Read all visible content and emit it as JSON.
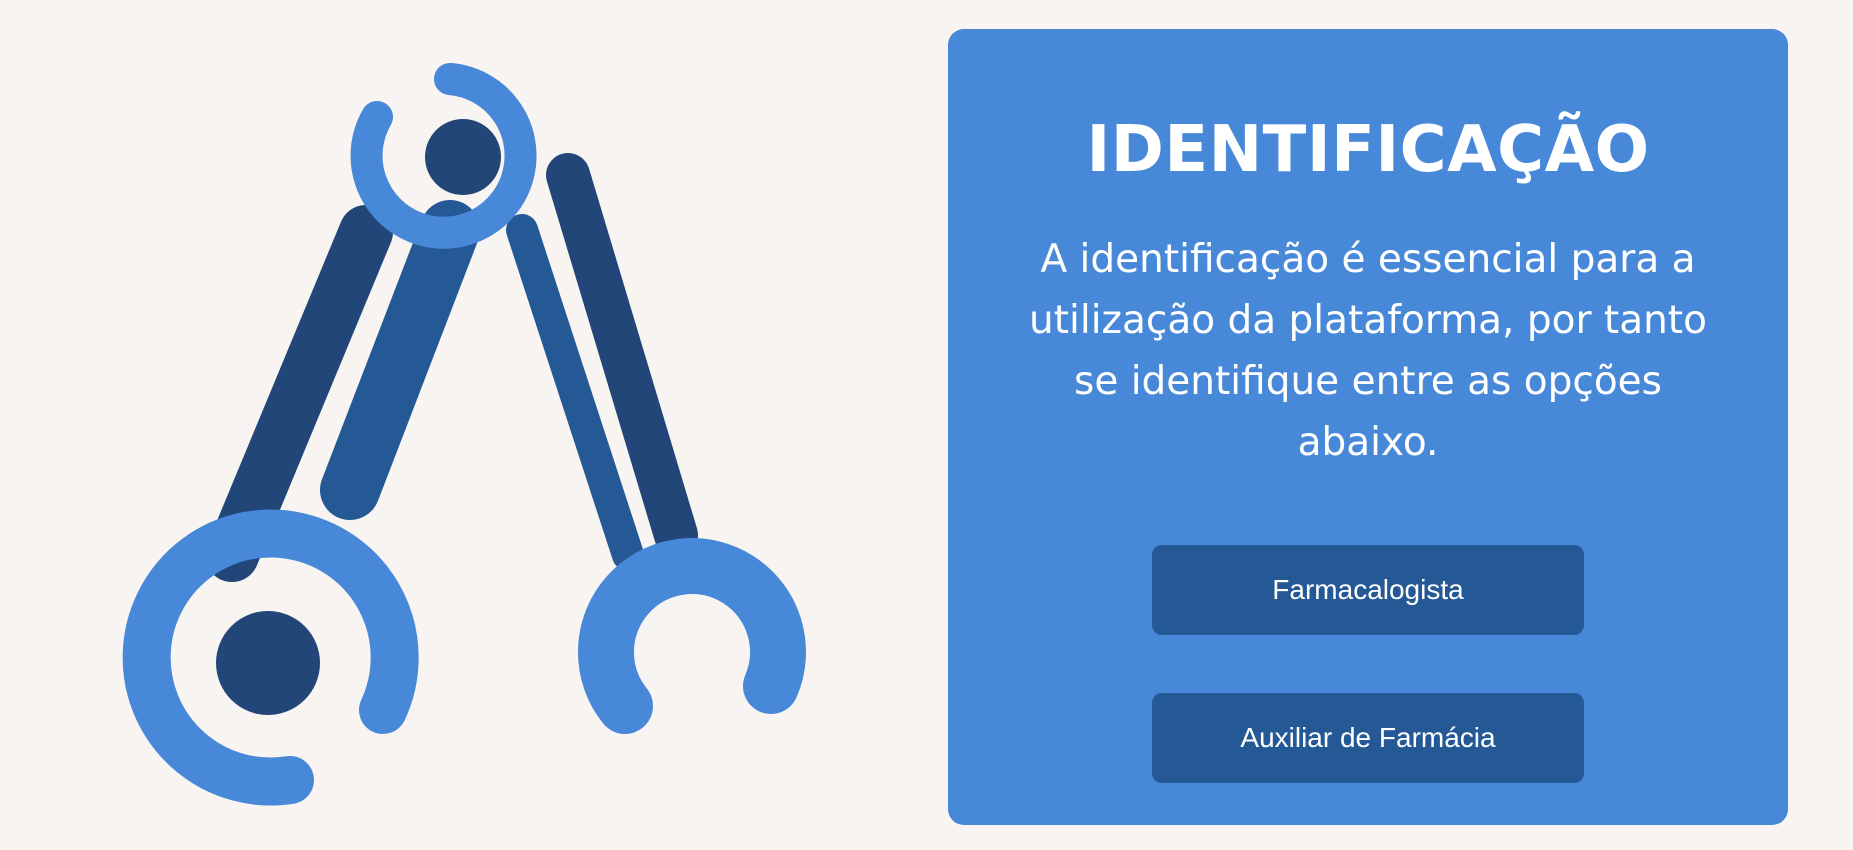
{
  "identification": {
    "title": "IDENTIFICAÇÃO",
    "description": "A identificação é essencial para a utilização da plataforma, por tanto se identifique entre as opções abaixo.",
    "options": [
      {
        "label": "Farmacalogista"
      },
      {
        "label": "Auxiliar de Farmácia"
      }
    ]
  },
  "illustration": {
    "icon": "crossed-wrenches-icon"
  },
  "colors": {
    "page_background": "#f7f4f1",
    "card_background": "#4888d8",
    "button_background": "#255995",
    "wrench_light": "#4888d8",
    "wrench_mid": "#255995",
    "wrench_dark": "#214677"
  }
}
